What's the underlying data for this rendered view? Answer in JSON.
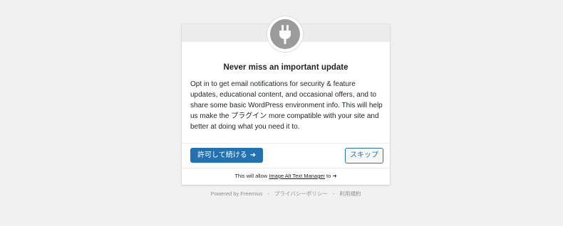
{
  "optin": {
    "headline": "Never miss an important update",
    "body": "Opt in to get email notifications for security & feature updates, educational content, and occasional offers, and to share some basic WordPress environment info. This will help us make the プラグイン more compatible with your site and better at doing what you need it to.",
    "allow_button_label": "許可して続ける",
    "allow_button_arrow": "➜",
    "skip_button_label": "スキップ",
    "permissions_prefix": "This will allow ",
    "plugin_name": "Image Alt Text Manager",
    "permissions_suffix": " to ",
    "permissions_arrow": "➜"
  },
  "footer": {
    "powered_by": "Powered by Freemius",
    "separator": "-",
    "privacy_policy": "プライバシーポリシー",
    "terms": "利用規約"
  },
  "icons": {
    "logo": "plug-icon"
  },
  "colors": {
    "primary": "#2271b1",
    "background": "#f1f1f1",
    "logo_gray": "#9b9b9b"
  }
}
